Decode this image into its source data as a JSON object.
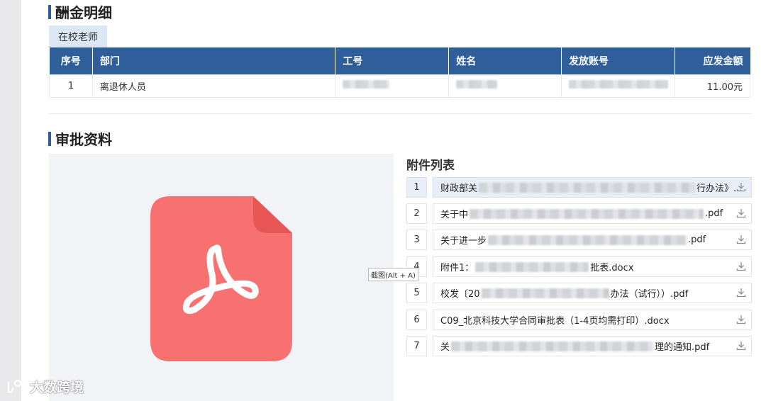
{
  "salary_section": {
    "title": "酬金明细",
    "tab_label": "在校老师",
    "headers": [
      "序号",
      "部门",
      "工号",
      "姓名",
      "发放账号",
      "应发金额"
    ],
    "rows": [
      {
        "index": "1",
        "department": "离退休人员",
        "amount": "11.00元"
      }
    ]
  },
  "approval_section": {
    "title": "审批资料",
    "preview_icon": "pdf-file-icon",
    "attachments_title": "附件列表",
    "attachments": [
      {
        "index": "1",
        "prefix": "财政部关",
        "suffix": "行办法》..."
      },
      {
        "index": "2",
        "prefix": "关于中",
        "suffix": ".pdf"
      },
      {
        "index": "3",
        "prefix": "关于进一步",
        "suffix": ".pdf"
      },
      {
        "index": "4",
        "prefix": "附件1：",
        "suffix": "批表.docx"
      },
      {
        "index": "5",
        "prefix": "校发〔20",
        "suffix": "办法（试行））.pdf"
      },
      {
        "index": "6",
        "prefix": "C09_北京科技大学合同审批表（1-4页均需打印）.docx",
        "suffix": ""
      },
      {
        "index": "7",
        "prefix": "关",
        "suffix": "理的通知.pdf"
      }
    ],
    "download_icon": "download-icon"
  },
  "tooltip": "截图(Alt + A)",
  "watermark": "大数跨境",
  "colors": {
    "header_blue": "#2f5f9a",
    "tab_bg": "#dbe7f5",
    "pdf_red": "#f87171",
    "active_row": "#e9eff8"
  }
}
